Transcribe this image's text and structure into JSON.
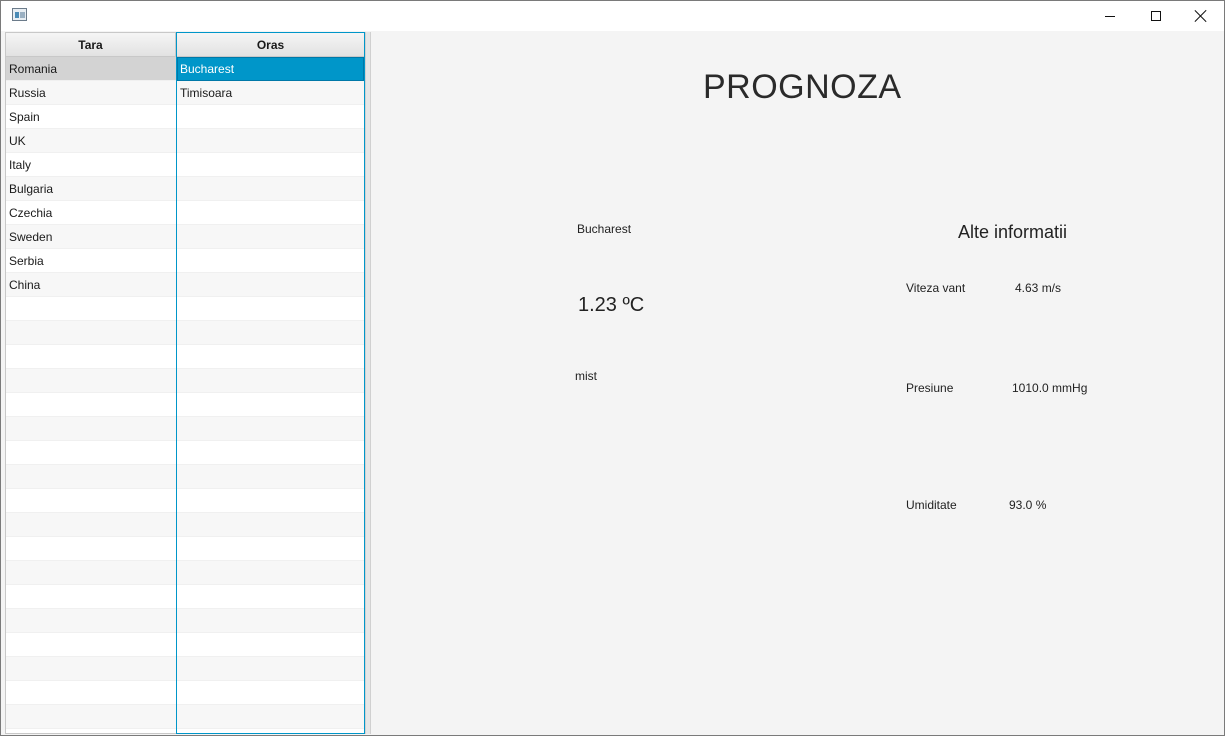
{
  "window": {
    "icon": "app-window-icon",
    "controls": [
      "minimize-icon",
      "maximize-icon",
      "close-icon"
    ]
  },
  "tara_table": {
    "header": "Tara",
    "rows": [
      "Romania",
      "Russia",
      "Spain",
      "UK",
      "Italy",
      "Bulgaria",
      "Czechia",
      "Sweden",
      "Serbia",
      "China"
    ],
    "selected": "Romania"
  },
  "oras_table": {
    "header": "Oras",
    "rows": [
      "Bucharest",
      "Timisoara"
    ],
    "selected": "Bucharest",
    "accent": "#0096c9"
  },
  "forecast": {
    "title": "PROGNOZA",
    "city": "Bucharest",
    "temperature": "1.23 ºC",
    "description": "mist",
    "other_title": "Alte informatii",
    "wind_label": "Viteza vant",
    "wind_value": "4.63 m/s",
    "pressure_label": "Presiune",
    "pressure_value": "1010.0 mmHg",
    "humidity_label": "Umiditate",
    "humidity_value": "93.0 %"
  }
}
